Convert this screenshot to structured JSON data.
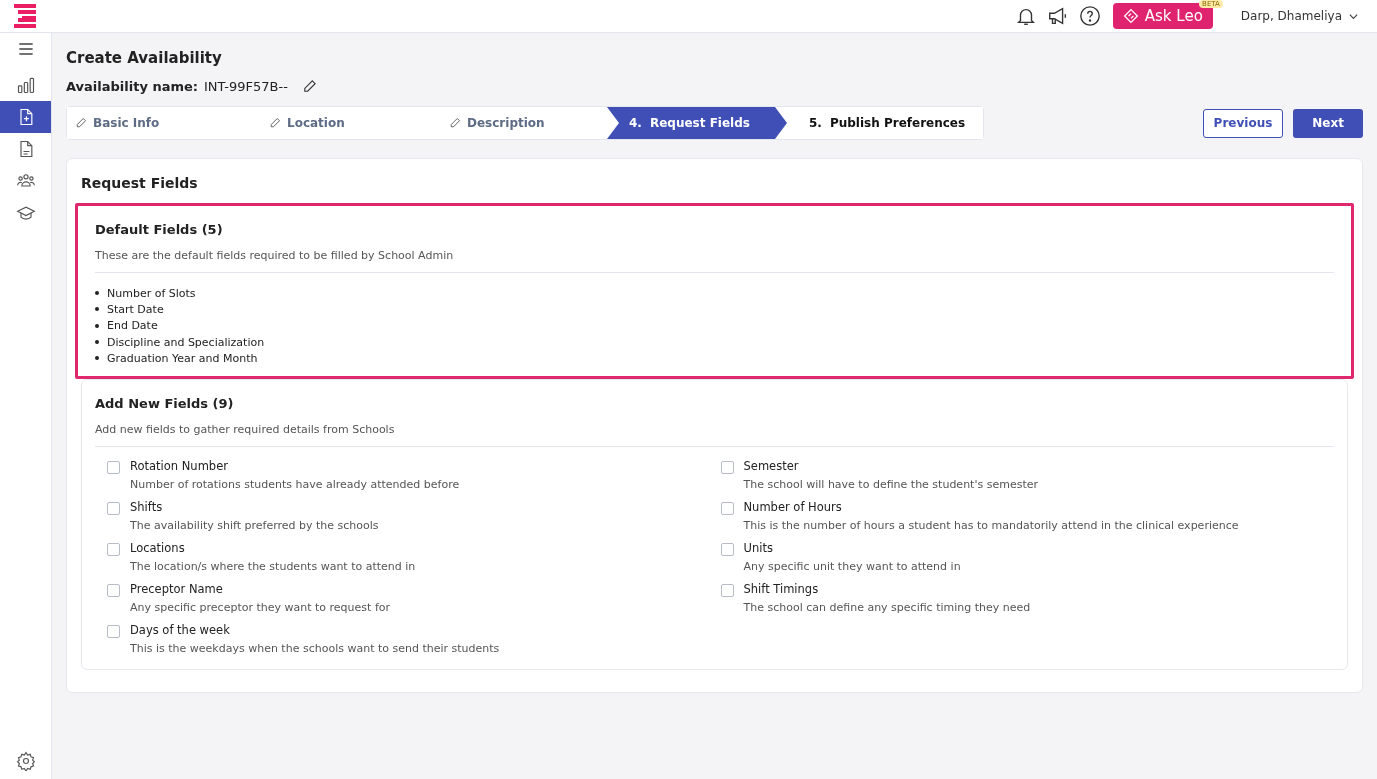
{
  "header": {
    "ask_button": "Ask Leo",
    "beta_badge": "BETA",
    "user": "Darp, Dhameliya"
  },
  "sidebar": {
    "items": [
      {
        "selected": false
      },
      {
        "selected": true
      },
      {
        "selected": false
      },
      {
        "selected": false
      },
      {
        "selected": false
      }
    ]
  },
  "page": {
    "title": "Create Availability",
    "name_label": "Availability name:",
    "name_value": "INT-99F57B--"
  },
  "steps": [
    {
      "label": "Basic Info",
      "completed": true,
      "selected": false
    },
    {
      "label": "Location",
      "completed": true,
      "selected": false
    },
    {
      "label": "Description",
      "completed": true,
      "selected": false
    },
    {
      "number": "4.",
      "label": "Request Fields",
      "completed": false,
      "selected": true
    },
    {
      "number": "5.",
      "label": "Publish Preferences",
      "completed": false,
      "selected": false
    }
  ],
  "buttons": {
    "previous": "Previous",
    "next": "Next"
  },
  "section_title": "Request Fields",
  "default_fields": {
    "title": "Default Fields (5)",
    "highlighted": true,
    "description": "These are the default fields required to be filled by School Admin",
    "items": [
      "Number of Slots",
      "Start Date",
      "End Date",
      "Discipline and Specialization",
      "Graduation Year and Month"
    ]
  },
  "new_fields": {
    "title": "Add New Fields (9)",
    "description": "Add new fields to gather required details from Schools",
    "items": [
      {
        "label": "Rotation Number",
        "hint": "Number of rotations students have already attended before",
        "checked": false
      },
      {
        "label": "Semester",
        "hint": "The school will have to define the student's semester",
        "checked": false
      },
      {
        "label": "Shifts",
        "hint": "The availability shift preferred by the schools",
        "checked": false
      },
      {
        "label": "Number of Hours",
        "hint": "This is the number of hours a student has to mandatorily attend in the clinical experience",
        "checked": false
      },
      {
        "label": "Locations",
        "hint": "The location/s where the students want to attend in",
        "checked": false
      },
      {
        "label": "Units",
        "hint": "Any specific unit they want to attend in",
        "checked": false
      },
      {
        "label": "Preceptor Name",
        "hint": "Any specific preceptor they want to request for",
        "checked": false
      },
      {
        "label": "Shift Timings",
        "hint": "The school can define any specific timing they need",
        "checked": false
      },
      {
        "label": "Days of the week",
        "hint": "This is the weekdays when the schools want to send their students",
        "checked": false
      }
    ]
  }
}
